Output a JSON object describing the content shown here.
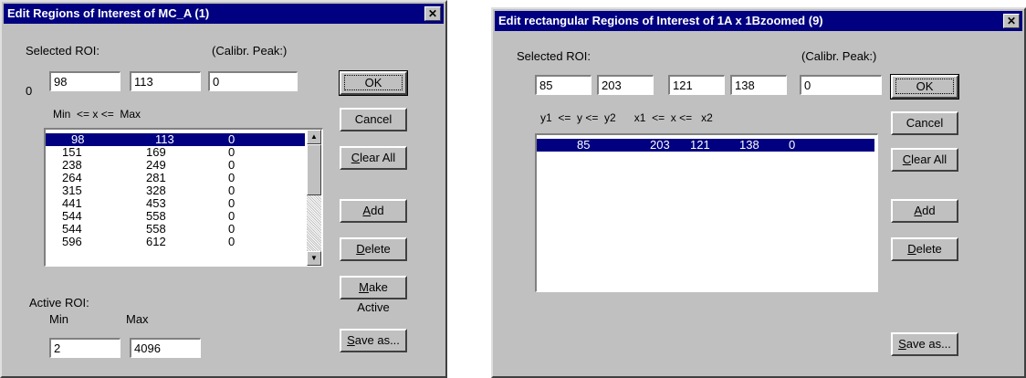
{
  "left": {
    "title": "Edit Regions of Interest of MC_A (1)",
    "close": "✕",
    "selected_label": "Selected ROI:",
    "calib_label": "(Calibr. Peak:)",
    "index": "0",
    "fields": {
      "min": "98",
      "max": "113",
      "calib": "0"
    },
    "range_header": "Min  <= x <=  Max",
    "rows": [
      [
        "98",
        "113",
        "0"
      ],
      [
        "151",
        "169",
        "0"
      ],
      [
        "238",
        "249",
        "0"
      ],
      [
        "264",
        "281",
        "0"
      ],
      [
        "315",
        "328",
        "0"
      ],
      [
        "441",
        "453",
        "0"
      ],
      [
        "544",
        "558",
        "0"
      ],
      [
        "544",
        "558",
        "0"
      ],
      [
        "596",
        "612",
        "0"
      ]
    ],
    "active_label": "Active ROI:",
    "active_min_label": "Min",
    "active_max_label": "Max",
    "active_min": "2",
    "active_max": "4096",
    "buttons": {
      "ok": "OK",
      "cancel": "Cancel",
      "clear_all": "Clear All",
      "add": "Add",
      "delete": "Delete",
      "make_active": "Make Active",
      "save_as": "Save as..."
    }
  },
  "right": {
    "title": "Edit rectangular Regions of Interest of 1A x 1Bzoomed (9)",
    "close": "✕",
    "selected_label": "Selected ROI:",
    "calib_label": "(Calibr. Peak:)",
    "fields": {
      "y1": "85",
      "y2": "203",
      "x1": "121",
      "x2": "138",
      "calib": "0"
    },
    "range_header": "y1  <=  y <=  y2      x1  <=  x <=   x2",
    "rows": [
      [
        "85",
        "203",
        "121",
        "138",
        "0"
      ]
    ],
    "buttons": {
      "ok": "OK",
      "cancel": "Cancel",
      "clear_all": "Clear All",
      "add": "Add",
      "delete": "Delete",
      "save_as": "Save as..."
    }
  }
}
